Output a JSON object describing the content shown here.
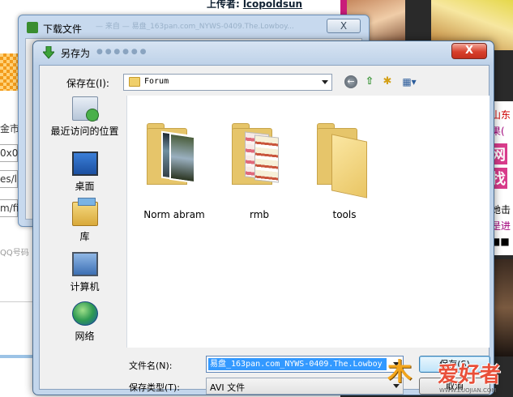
{
  "background_page": {
    "uploader_label": "上传者:",
    "uploader_name": "lcopoldsun",
    "fragments": [
      "金市",
      "0x0",
      "es/li",
      "m/fi"
    ],
    "qq_hint": "QQ号码",
    "ads": {
      "line1": "山东",
      "line2": "果(",
      "banner1": "网",
      "banner2": "找",
      "line3": "她击",
      "line4": "是进",
      "line5": "■■"
    }
  },
  "download_dialog": {
    "title": "下载文件",
    "title_blurred": "— 来自 — 易盘_163pan.com_NYWS-0409.The.Lowboy...",
    "close_label": "X"
  },
  "save_dialog": {
    "title": "另存为",
    "title_blurred": "● ● ● ● ● ●",
    "close_label": "X",
    "location_label": "保存在(I):",
    "location_value": "Forum",
    "toolbar": {
      "back_icon": "back-arrow-icon",
      "up_icon": "up-folder-icon",
      "new_folder_icon": "new-folder-icon",
      "view_icon": "view-menu-icon"
    },
    "places": [
      {
        "label": "最近访问的位置",
        "icon": "recent-places-icon"
      },
      {
        "label": "桌面",
        "icon": "desktop-icon"
      },
      {
        "label": "库",
        "icon": "library-icon"
      },
      {
        "label": "计算机",
        "icon": "computer-icon"
      },
      {
        "label": "网络",
        "icon": "network-icon"
      }
    ],
    "folders": [
      {
        "name": "Norm abram"
      },
      {
        "name": "rmb"
      },
      {
        "name": "tools"
      }
    ],
    "filename_label": "文件名(N):",
    "filename_value": "易盘_163pan.com_NYWS-0409.The.Lowboy",
    "filetype_label": "保存类型(T):",
    "filetype_value": "AVI 文件",
    "save_button": "保存(S)",
    "cancel_button": "取消"
  },
  "watermark": {
    "mark": "木",
    "text": "爱好者",
    "url": "WWW.ZUOJIAN.COM"
  },
  "colors": {
    "accent": "#3399ff",
    "close_red": "#d8402c",
    "folder": "#e6c56a"
  }
}
